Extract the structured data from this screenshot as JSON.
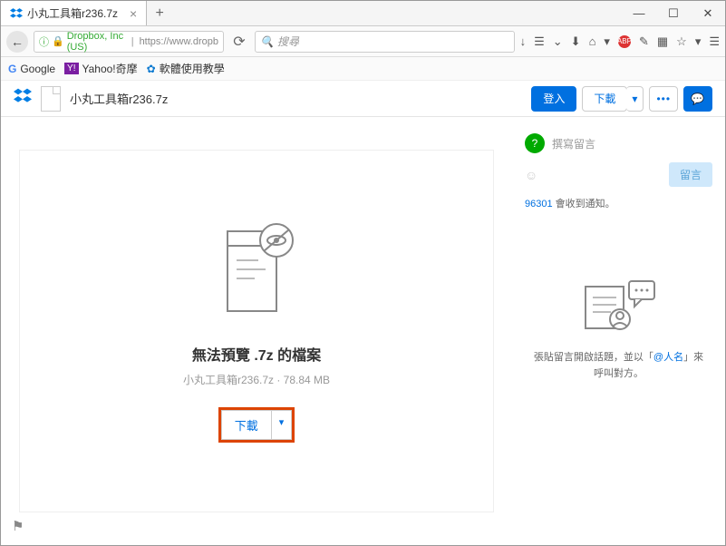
{
  "browser": {
    "tab_title": "小丸工具箱r236.7z",
    "window_buttons": {
      "min": "—",
      "max": "☐",
      "close": "✕"
    },
    "newtab": "+"
  },
  "url": {
    "back": "←",
    "lock": "🔒",
    "domain": "Dropbox, Inc (US)",
    "path": "https://www.dropb",
    "reload": "⟳",
    "search_placeholder": "搜尋"
  },
  "bookmarks": {
    "google": "Google",
    "yahoo": "Yahoo!奇摩",
    "soft": "軟體使用教學"
  },
  "header": {
    "filename": "小丸工具箱r236.7z",
    "login": "登入",
    "download": "下載",
    "dd_arrow": "▾",
    "more": "•••",
    "chat": "💬"
  },
  "preview": {
    "title": "無法預覽 .7z 的檔案",
    "info": "小丸工具箱r236.7z · 78.84 MB",
    "download": "下載",
    "dd": "▾"
  },
  "comments": {
    "avatar": "?",
    "placeholder": "撰寫留言",
    "emoji": "☺",
    "post": "留言",
    "notif_count": "96301",
    "notif_text": " 會收到通知。",
    "hint_pre": "張貼留言開啟話題，並以「",
    "hint_at": "@人名",
    "hint_post": "」來呼叫對方。"
  },
  "flag": "⚑"
}
